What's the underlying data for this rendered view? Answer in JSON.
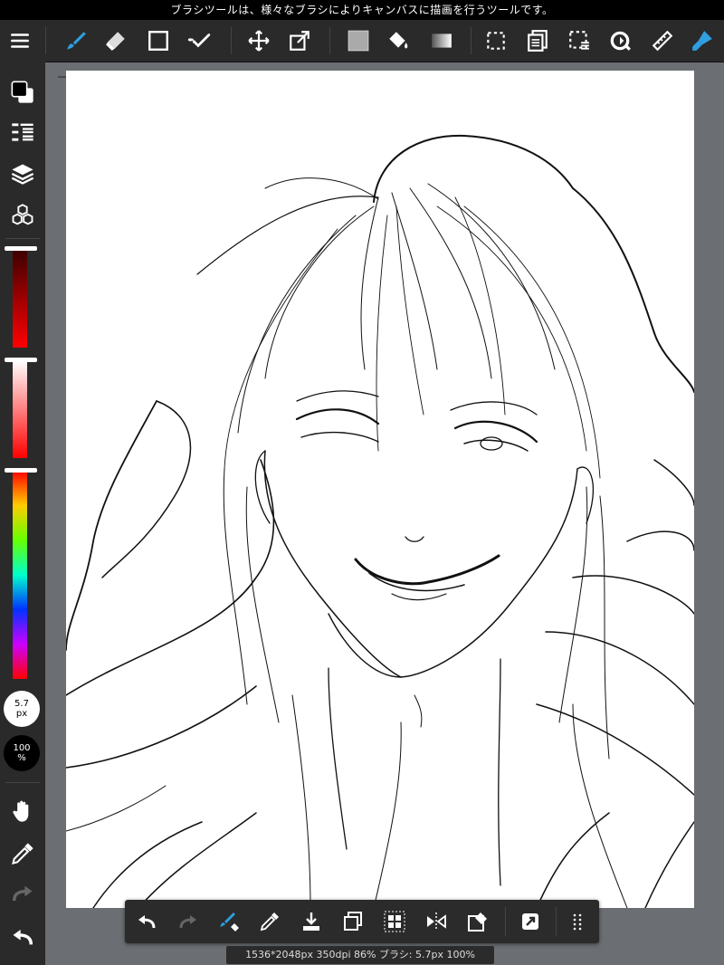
{
  "hint": "ブラシツールは、様々なブラシによりキャンバスに描画を行うツールです。",
  "status": "1536*2048px 350dpi 86% ブラシ: 5.7px 100%",
  "brush": {
    "size_value": "5.7",
    "size_unit": "px",
    "opacity_value": "100",
    "opacity_unit": "%"
  },
  "colors": {
    "accent": "#2f9fe0",
    "ui_bg": "#2a2a2a",
    "workspace": "#6b6e72",
    "foreground_color": "#000000",
    "background_color": "#ffffff"
  },
  "toolbar_icons": [
    "menu-icon",
    "brush-icon",
    "eraser-icon",
    "rectangle-icon",
    "select-check-icon",
    "move-icon",
    "transform-icon",
    "fill-color-icon",
    "bucket-icon",
    "gradient-icon",
    "selection-icon",
    "copy-layer-icon",
    "deselect-icon",
    "rotate-icon",
    "ruler-icon",
    "pen-nib-icon"
  ],
  "sidebar_icons": [
    "color-swatch-icon",
    "layer-list-icon",
    "layers-icon",
    "materials-icon",
    "hand-icon",
    "eyedropper-icon",
    "redo-icon",
    "undo-icon"
  ],
  "bottom_icons": [
    "undo-icon",
    "redo-icon",
    "brush-eraser-toggle-icon",
    "eyedropper-icon",
    "download-icon",
    "duplicate-icon",
    "grid-icon",
    "flip-icon",
    "clear-icon",
    "export-icon",
    "more-icon"
  ]
}
